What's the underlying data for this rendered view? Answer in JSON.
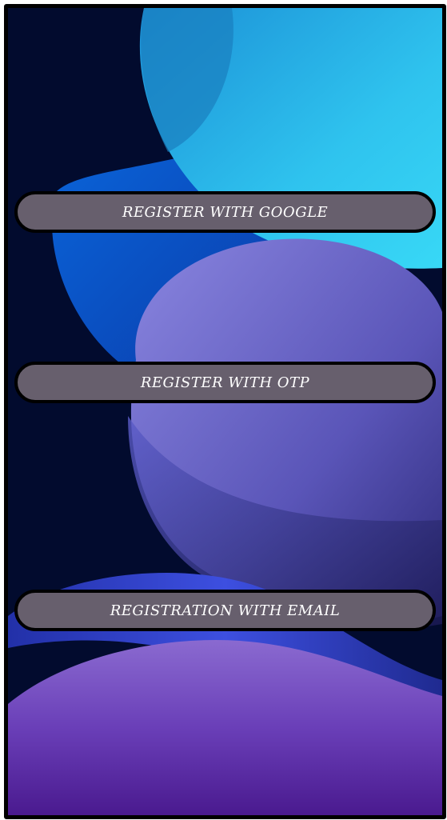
{
  "screen": {
    "background_color": "#020b2e",
    "button_color": "#675f6d",
    "button_text_color": "#ffffff"
  },
  "buttons": {
    "google_label": "REGISTER WITH GOOGLE",
    "otp_label": "REGISTER WITH OTP",
    "email_label": "REGISTRATION WITH EMAIL"
  }
}
